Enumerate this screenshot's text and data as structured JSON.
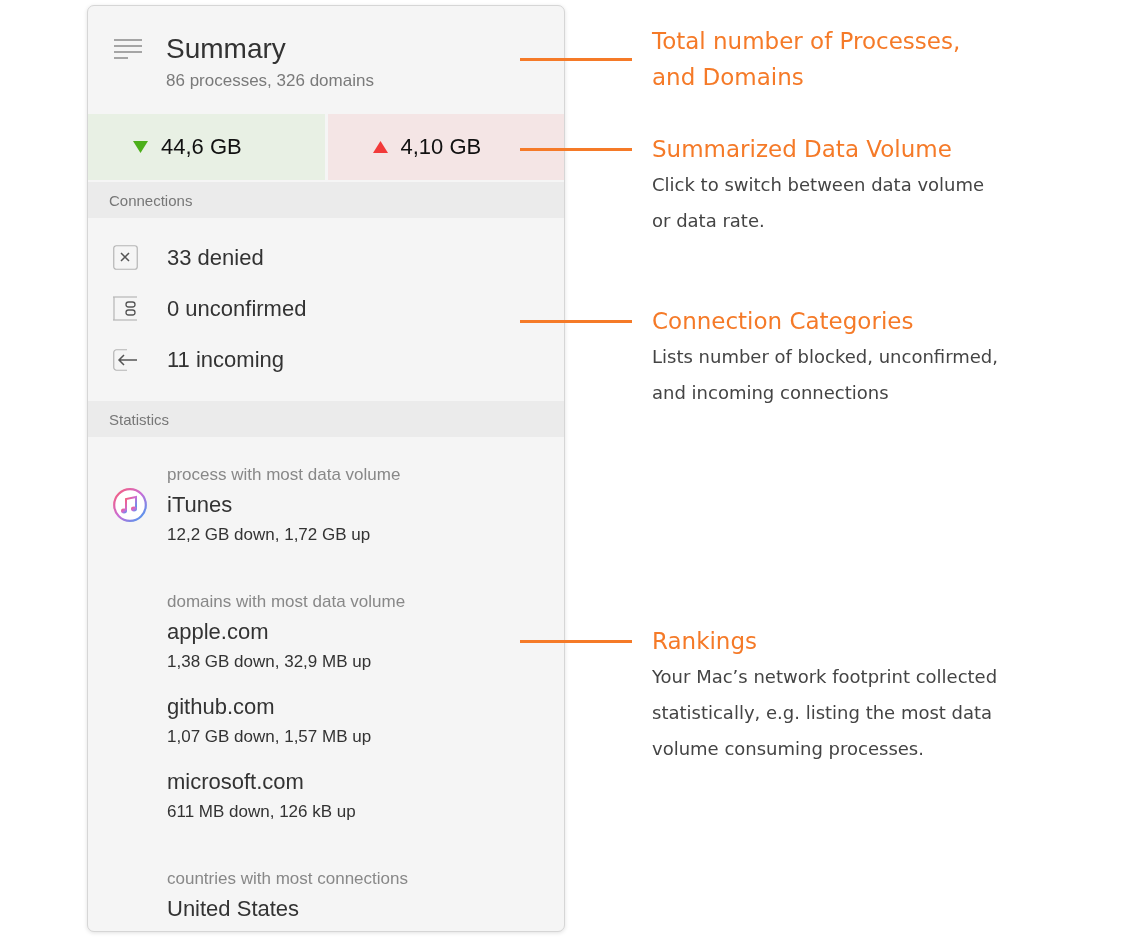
{
  "panel": {
    "title": "Summary",
    "subtitle": "86 processes, 326 domains",
    "volumes": [
      {
        "kind": "download",
        "value": "44,6 GB"
      },
      {
        "kind": "upload",
        "value": "4,10 GB"
      }
    ],
    "connections": {
      "heading": "Connections",
      "items": [
        {
          "kind": "denied",
          "label": "33 denied"
        },
        {
          "kind": "unconfirmed",
          "label": "0 unconfirmed"
        },
        {
          "kind": "incoming",
          "label": "11 incoming"
        }
      ]
    },
    "statistics": {
      "heading": "Statistics",
      "groups": [
        {
          "caption": "process with most data volume",
          "entries": [
            {
              "kind": "app",
              "name": "iTunes",
              "detail": "12,2 GB down, 1,72 GB up"
            }
          ]
        },
        {
          "caption": "domains with most data volume",
          "entries": [
            {
              "kind": "domain",
              "name": "apple.com",
              "detail": "1,38 GB down, 32,9 MB up"
            },
            {
              "kind": "domain",
              "name": "github.com",
              "detail": "1,07 GB down, 1,57 MB up"
            },
            {
              "kind": "domain",
              "name": "microsoft.com",
              "detail": "611 MB down, 126 kB up"
            }
          ]
        },
        {
          "caption": "countries with most connections",
          "entries": [
            {
              "kind": "country",
              "name": "United States"
            }
          ]
        }
      ]
    }
  },
  "callouts": [
    {
      "title": "Total number of Processes, and Domains"
    },
    {
      "title": "Summarized Data Volume",
      "description": "Click to switch between data volume or data rate."
    },
    {
      "title": "Connection Categories",
      "description": "Lists number of blocked, unconfirmed, and incoming connections"
    },
    {
      "title": "Rankings",
      "description": "Your Mac’s network footprint collected statistically, e.g. listing the most data volume consuming processes."
    }
  ]
}
